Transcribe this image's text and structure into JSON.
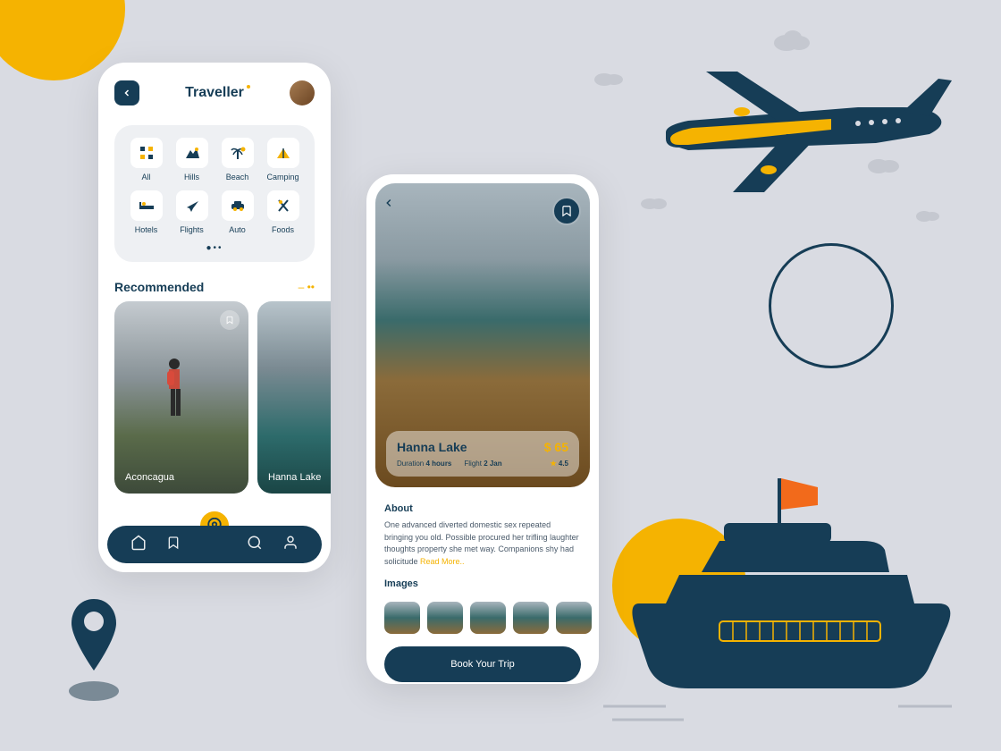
{
  "app": {
    "title": "Traveller"
  },
  "categories": [
    {
      "label": "All",
      "icon": "grid"
    },
    {
      "label": "Hills",
      "icon": "mountain"
    },
    {
      "label": "Beach",
      "icon": "palm"
    },
    {
      "label": "Camping",
      "icon": "tent"
    },
    {
      "label": "Hotels",
      "icon": "bed"
    },
    {
      "label": "Flights",
      "icon": "plane"
    },
    {
      "label": "Auto",
      "icon": "car"
    },
    {
      "label": "Foods",
      "icon": "utensils"
    }
  ],
  "recommended": {
    "title": "Recommended",
    "cards": [
      {
        "name": "Aconcagua"
      },
      {
        "name": "Hanna Lake"
      }
    ]
  },
  "detail": {
    "name": "Hanna Lake",
    "price": "$ 65",
    "duration_label": "Duration",
    "duration_value": "4 hours",
    "flight_label": "Flight",
    "flight_value": "2 Jan",
    "rating": "4.5",
    "about_title": "About",
    "about_text": "One advanced diverted domestic sex repeated bringing you old. Possible procured her trifling laughter thoughts property she met way. Companions shy had solicitude ",
    "read_more": "Read More..",
    "images_title": "Images",
    "book_button": "Book Your Trip"
  }
}
